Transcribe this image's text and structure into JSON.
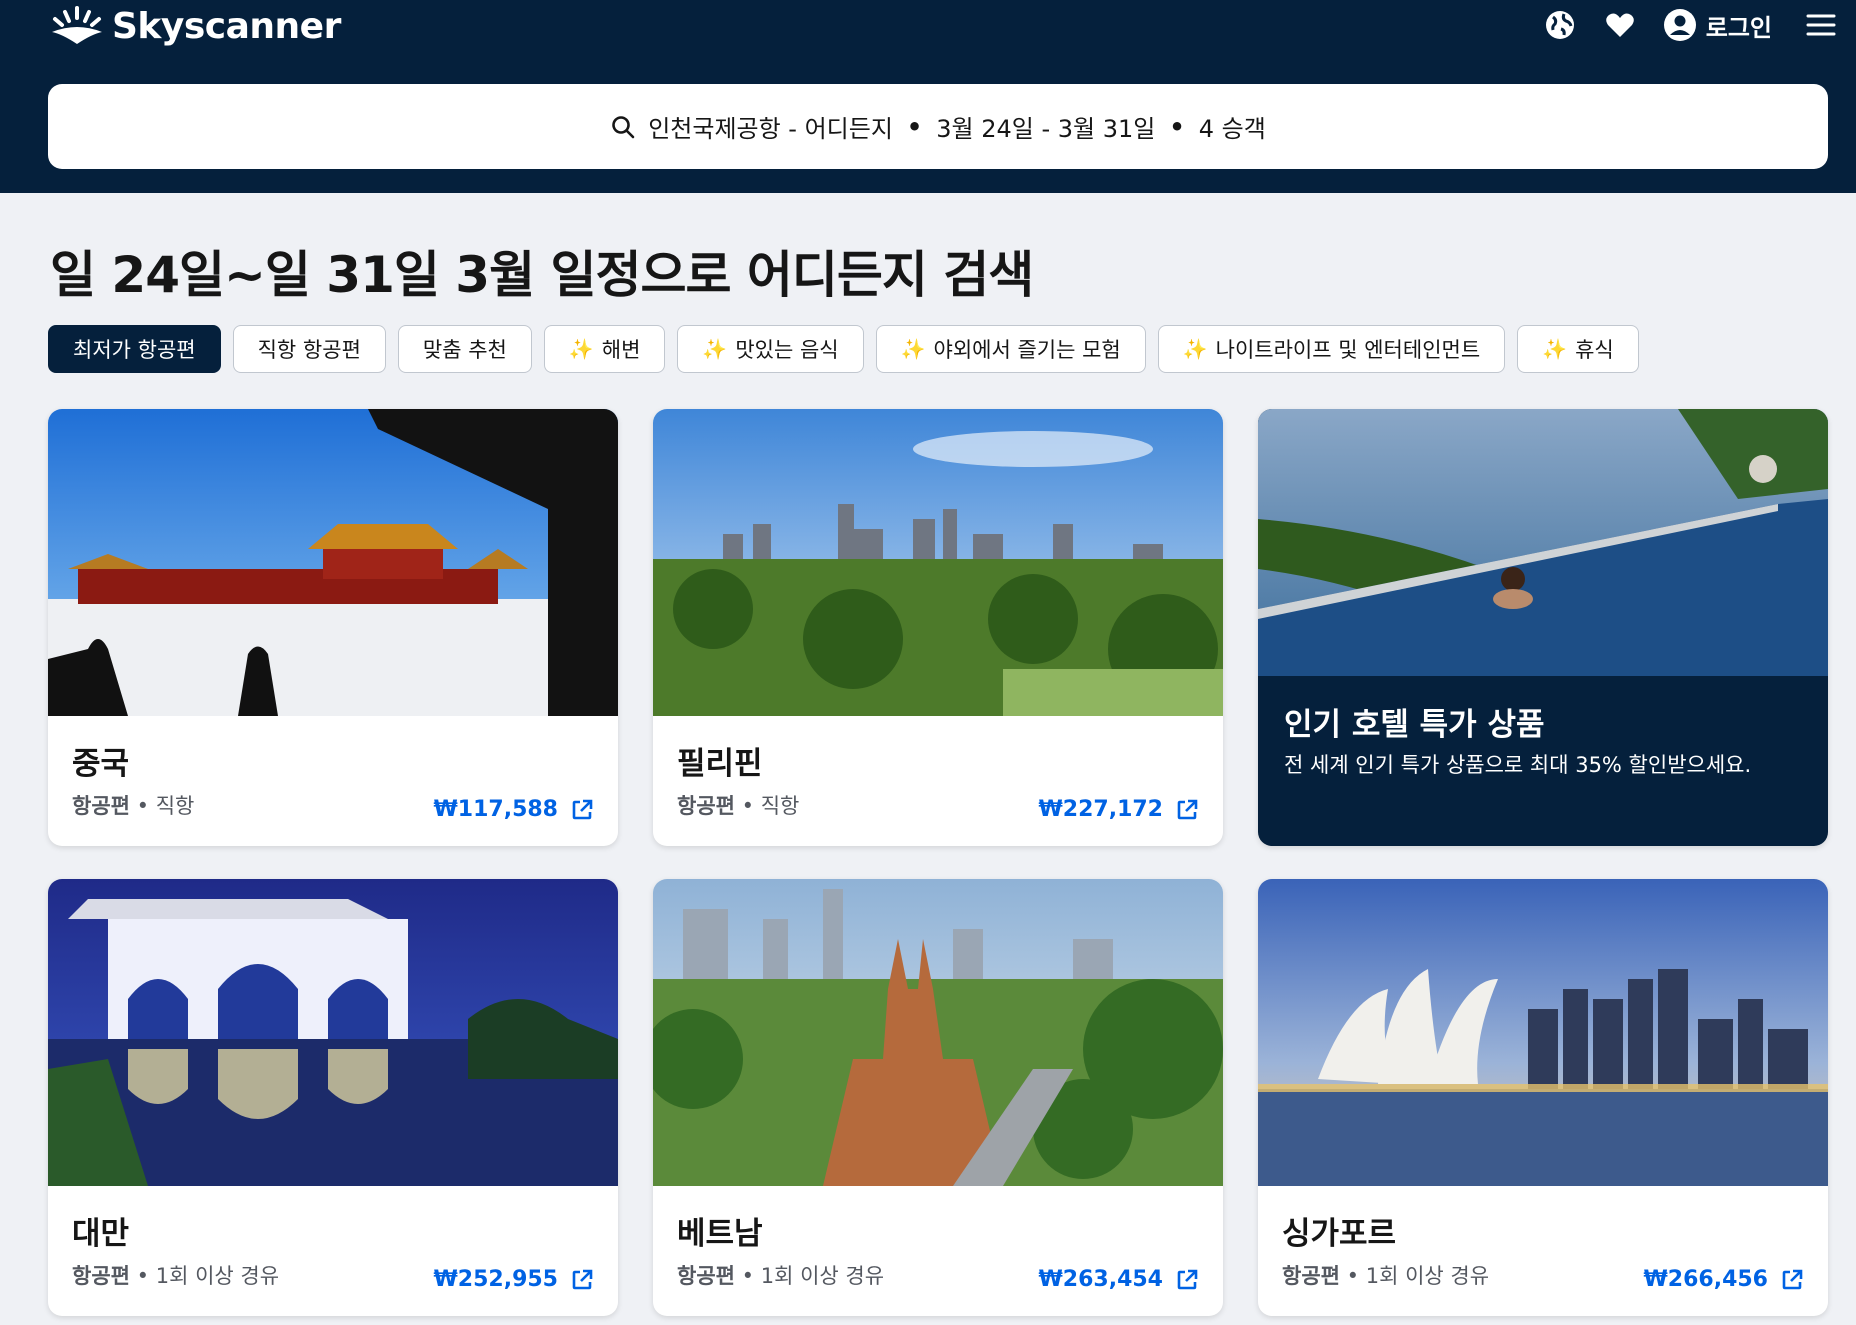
{
  "header": {
    "brand": "Skyscanner",
    "login_label": "로그인"
  },
  "search": {
    "route": "인천국제공항 - 어디든지",
    "dates": "3월 24일 - 3월 31일",
    "travelers": "4 승객"
  },
  "page_title": "일 24일~일 31일 3월 일정으로 어디든지 검색",
  "chips": [
    {
      "label": "최저가 항공편",
      "active": true,
      "sparkle": false
    },
    {
      "label": "직항 항공편",
      "active": false,
      "sparkle": false
    },
    {
      "label": "맞춤 추천",
      "active": false,
      "sparkle": false
    },
    {
      "label": "해변",
      "active": false,
      "sparkle": true
    },
    {
      "label": "맛있는 음식",
      "active": false,
      "sparkle": true
    },
    {
      "label": "야외에서 즐기는 모험",
      "active": false,
      "sparkle": true
    },
    {
      "label": "나이트라이프 및 엔터테인먼트",
      "active": false,
      "sparkle": true
    },
    {
      "label": "휴식",
      "active": false,
      "sparkle": true
    }
  ],
  "destinations": [
    {
      "name": "중국",
      "type": "항공편",
      "stops": "직항",
      "price": "₩117,588"
    },
    {
      "name": "필리핀",
      "type": "항공편",
      "stops": "직항",
      "price": "₩227,172"
    },
    {
      "name": "대만",
      "type": "항공편",
      "stops": "1회 이상 경유",
      "price": "₩252,955"
    },
    {
      "name": "베트남",
      "type": "항공편",
      "stops": "1회 이상 경유",
      "price": "₩263,454"
    },
    {
      "name": "싱가포르",
      "type": "항공편",
      "stops": "1회 이상 경유",
      "price": "₩266,456"
    }
  ],
  "promo": {
    "title": "인기 호텔 특가 상품",
    "subtitle": "전 세계 인기 특가 상품으로 최대 35% 할인받으세요."
  },
  "colors": {
    "header_bg": "#05203c",
    "page_bg": "#eff1f5",
    "price_blue": "#0062e3",
    "sparkle": "#f5b50a"
  },
  "icons": [
    "sun-logo-icon",
    "globe-icon",
    "heart-icon",
    "user-icon",
    "menu-icon",
    "search-icon",
    "sparkle-icon",
    "external-link-icon"
  ]
}
